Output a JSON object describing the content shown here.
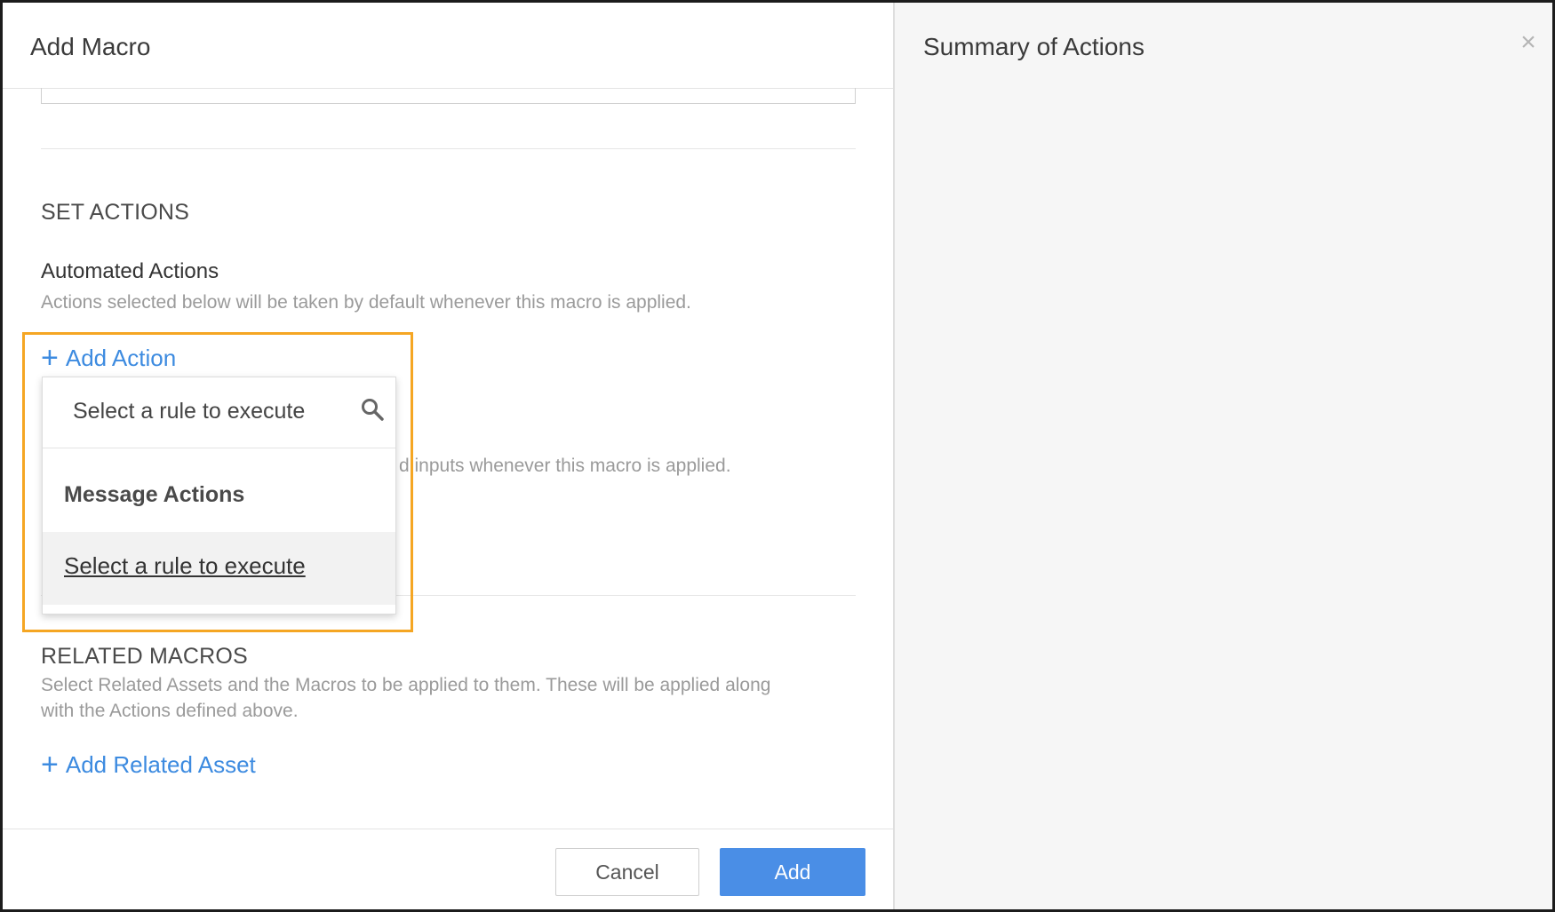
{
  "left_panel": {
    "title": "Add Macro",
    "set_actions": {
      "heading": "SET ACTIONS",
      "automated_title": "Automated Actions",
      "automated_help": "Actions selected below will be taken by default whenever this macro is applied.",
      "add_action_label": "Add Action",
      "hidden_help_fragment": "d inputs whenever this macro is applied."
    },
    "dropdown": {
      "search_placeholder": "Select a rule to execute",
      "search_icon": "search-icon",
      "group_label": "Message Actions",
      "option_label": "Select a rule to execute"
    },
    "related_macros": {
      "heading": "RELATED MACROS",
      "help_line1": "Select Related Assets and the Macros to be applied to them. These will be applied along",
      "help_line2": "with the Actions defined above.",
      "add_related_label": "Add Related Asset"
    },
    "footer": {
      "cancel_label": "Cancel",
      "add_label": "Add"
    }
  },
  "right_panel": {
    "title": "Summary of Actions",
    "close_icon": "close-icon",
    "close_glyph": "×"
  },
  "colors": {
    "accent": "#3d8be0",
    "primary_button": "#4a8ee6",
    "highlight": "#f5a623",
    "right_panel_bg": "#f6f6f6"
  }
}
